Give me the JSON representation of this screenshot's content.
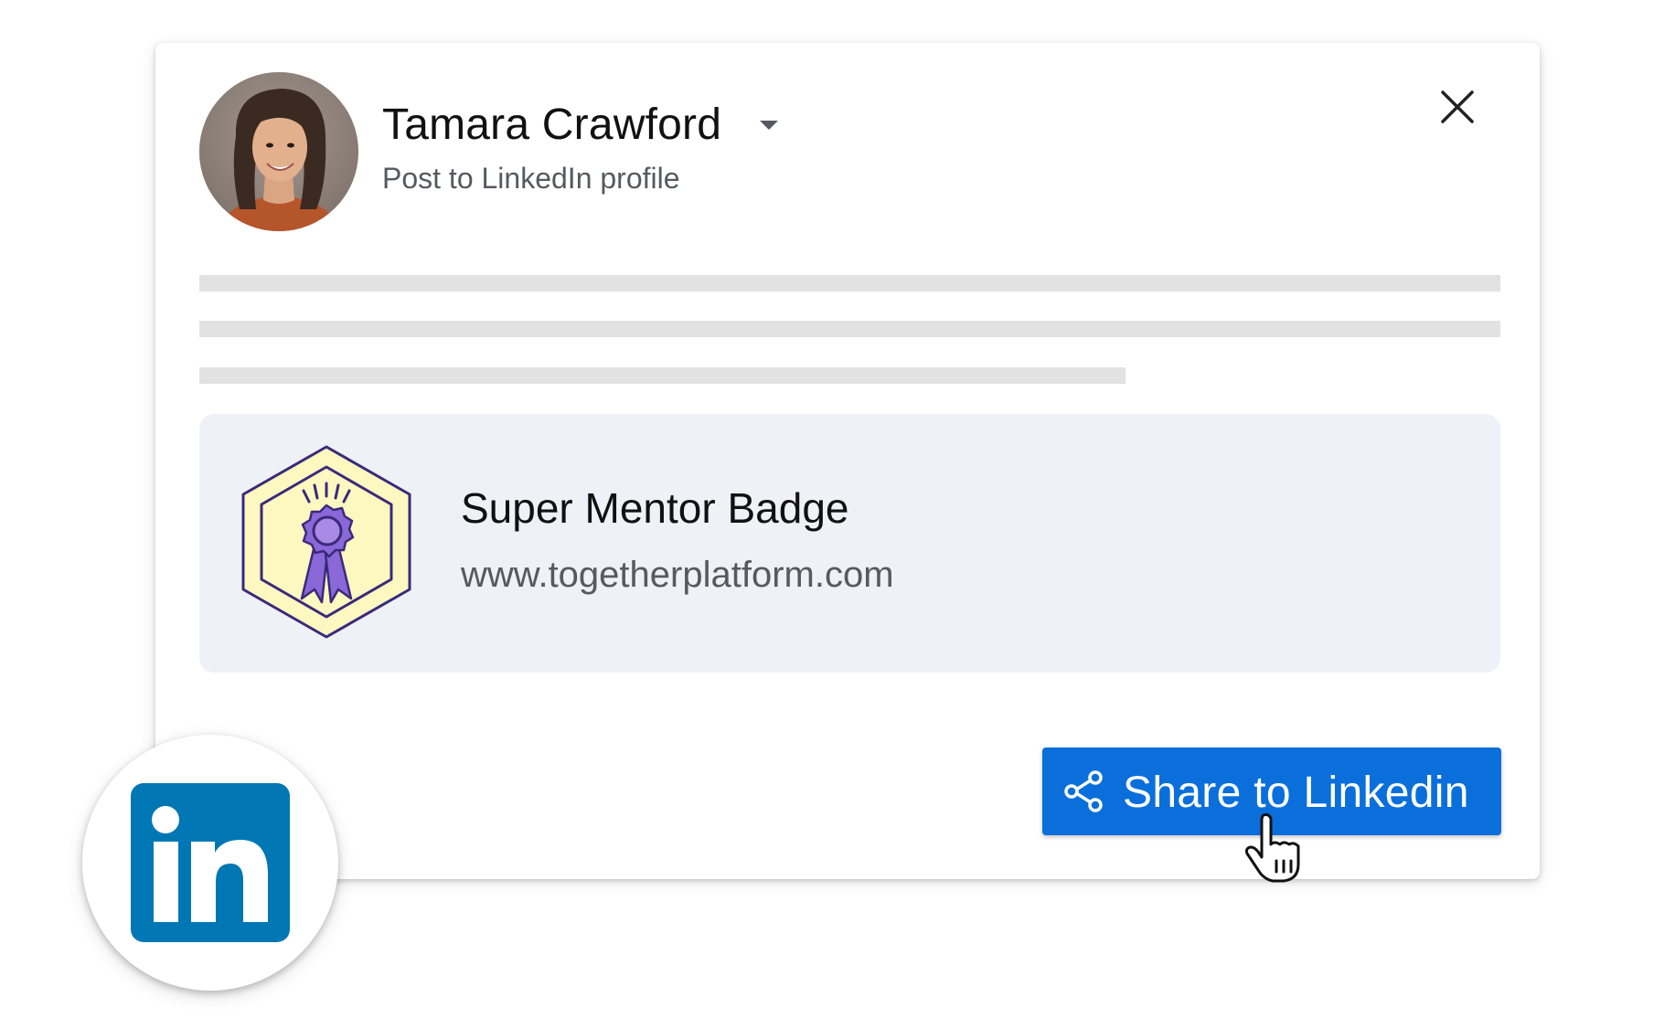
{
  "post_dialog": {
    "user_name": "Tamara Crawford",
    "subtitle": "Post to LinkedIn profile",
    "badge": {
      "title": "Super Mentor Badge",
      "url": "www.togetherplatform.com"
    },
    "share_button_label": "Share to Linkedin"
  },
  "icons": {
    "avatar": "person-photo",
    "dropdown": "chevron-down-icon",
    "close": "close-icon",
    "badge": "ribbon-badge-icon",
    "share": "share-icon",
    "cursor": "hand-pointer-icon",
    "linkedin": "linkedin-logo-icon"
  },
  "colors": {
    "accent": "#0a6fdb",
    "linkedin_blue": "#0077b5",
    "badge_card_bg": "#eef1f6",
    "badge_purple": "#8a68d8",
    "badge_yellow": "#fdf8c0",
    "placeholder_line": "#e2e2e2"
  }
}
